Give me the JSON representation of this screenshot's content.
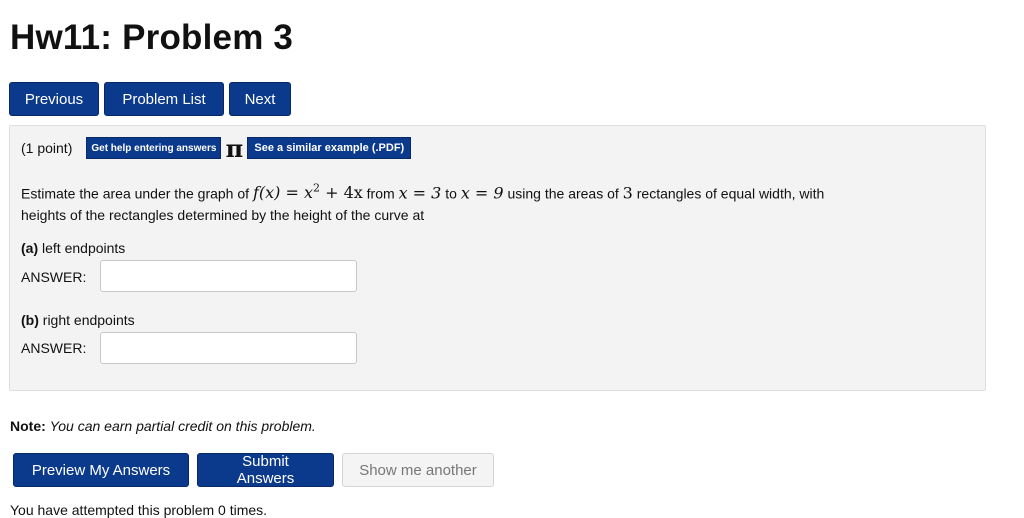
{
  "page": {
    "title": "Hw11: Problem 3"
  },
  "nav": {
    "previous": "Previous",
    "problem_list": "Problem List",
    "next": "Next"
  },
  "problem": {
    "points": "(1 point)",
    "help_button": "Get help entering answers",
    "pi_icon": "π",
    "example_button": "See a similar example (.PDF)",
    "statement": {
      "t1": "Estimate the area under the graph of",
      "t2": "from",
      "t3": "to",
      "t4": "using the areas of",
      "t5": "rectangles of equal width, with",
      "t6": "heights of the rectangles determined by the height of the curve at",
      "fx_lhs": "f(x)",
      "fx_rhs_base": "x",
      "fx_exp": "2",
      "fx_rest": "+ 4x",
      "x_start": "x = 3",
      "x_end": "x = 9",
      "n_rect": "3"
    },
    "parts": [
      {
        "letter": "(a)",
        "label": "left endpoints",
        "answer_label": "ANSWER:",
        "answer_value": ""
      },
      {
        "letter": "(b)",
        "label": "right endpoints",
        "answer_label": "ANSWER:",
        "answer_value": ""
      }
    ]
  },
  "note": {
    "label": "Note:",
    "text": "You can earn partial credit on this problem."
  },
  "actions": {
    "preview": "Preview My Answers",
    "submit": "Submit Answers",
    "another": "Show me another"
  },
  "footer": {
    "attempts": "You have attempted this problem 0 times."
  },
  "colors": {
    "button_blue": "#0b3a8c",
    "panel_bg": "#f3f3f3"
  },
  "icons": {
    "pi": "pi-icon"
  }
}
